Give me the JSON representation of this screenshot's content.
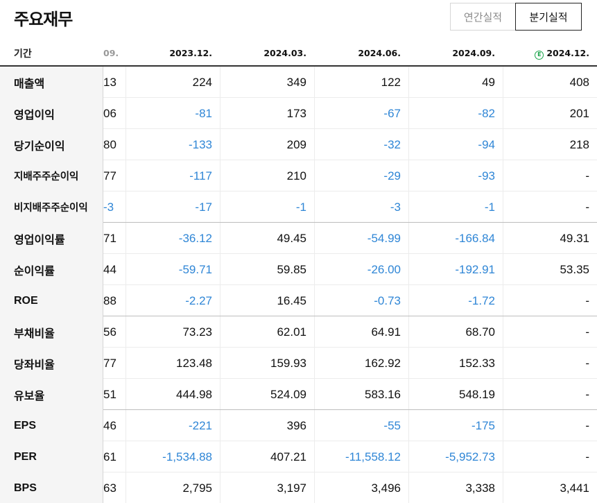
{
  "title": "주요재무",
  "toggle": {
    "annual": "연간실적",
    "quarterly": "분기실적"
  },
  "header": {
    "label": "기간",
    "columns": [
      "09.",
      "2023.12.",
      "2024.03.",
      "2024.06.",
      "2024.09.",
      "2024.12."
    ],
    "estimate_icon": "Ⓔ"
  },
  "colors": {
    "negative": "#2f86d6",
    "estimate": "#1aa34a",
    "label_bg": "#f5f5f5"
  },
  "rows": [
    {
      "label": "매출액",
      "values": [
        "13",
        "224",
        "349",
        "122",
        "49",
        "408"
      ]
    },
    {
      "label": "영업이익",
      "values": [
        "06",
        "-81",
        "173",
        "-67",
        "-82",
        "201"
      ]
    },
    {
      "label": "당기순이익",
      "values": [
        "80",
        "-133",
        "209",
        "-32",
        "-94",
        "218"
      ]
    },
    {
      "label": "지배주주순이익",
      "values": [
        "77",
        "-117",
        "210",
        "-29",
        "-93",
        "-"
      ]
    },
    {
      "label": "비지배주주순이익",
      "values": [
        "-3",
        "-17",
        "-1",
        "-3",
        "-1",
        "-"
      ]
    },
    {
      "label": "영업이익률",
      "values": [
        "71",
        "-36.12",
        "49.45",
        "-54.99",
        "-166.84",
        "49.31"
      ]
    },
    {
      "label": "순이익률",
      "values": [
        "44",
        "-59.71",
        "59.85",
        "-26.00",
        "-192.91",
        "53.35"
      ]
    },
    {
      "label": "ROE",
      "values": [
        "88",
        "-2.27",
        "16.45",
        "-0.73",
        "-1.72",
        "-"
      ]
    },
    {
      "label": "부채비율",
      "values": [
        "56",
        "73.23",
        "62.01",
        "64.91",
        "68.70",
        "-"
      ]
    },
    {
      "label": "당좌비율",
      "values": [
        "77",
        "123.48",
        "159.93",
        "162.92",
        "152.33",
        "-"
      ]
    },
    {
      "label": "유보율",
      "values": [
        "51",
        "444.98",
        "524.09",
        "583.16",
        "548.19",
        "-"
      ]
    },
    {
      "label": "EPS",
      "values": [
        "46",
        "-221",
        "396",
        "-55",
        "-175",
        "-"
      ]
    },
    {
      "label": "PER",
      "values": [
        "61",
        "-1,534.88",
        "407.21",
        "-11,558.12",
        "-5,952.73",
        "-"
      ]
    },
    {
      "label": "BPS",
      "values": [
        "63",
        "2,795",
        "3,197",
        "3,496",
        "3,338",
        "3,441"
      ]
    }
  ]
}
